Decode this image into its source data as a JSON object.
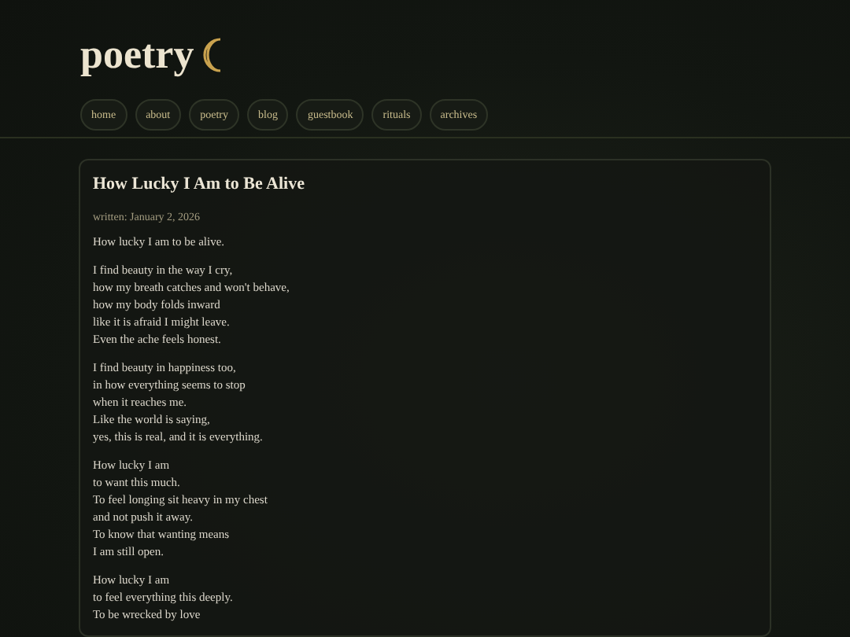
{
  "site": {
    "title": "poetry",
    "nav": [
      {
        "label": "home"
      },
      {
        "label": "about"
      },
      {
        "label": "poetry"
      },
      {
        "label": "blog"
      },
      {
        "label": "guestbook"
      },
      {
        "label": "rituals"
      },
      {
        "label": "archives"
      }
    ]
  },
  "post": {
    "title": "How Lucky I Am to Be Alive",
    "date": "written: January 2, 2026",
    "stanzas": [
      [
        "How lucky I am to be alive."
      ],
      [
        "I find beauty in the way I cry,",
        "how my breath catches and won't behave,",
        "how my body folds inward",
        "like it is afraid I might leave.",
        "Even the ache feels honest."
      ],
      [
        "I find beauty in happiness too,",
        "in how everything seems to stop",
        "when it reaches me.",
        "Like the world is saying,",
        "yes, this is real, and it is everything."
      ],
      [
        "How lucky I am",
        "to want this much.",
        "To feel longing sit heavy in my chest",
        "and not push it away.",
        "To know that wanting means",
        "I am still open."
      ],
      [
        "How lucky I am",
        "to feel everything this deeply.",
        "To be wrecked by love"
      ]
    ]
  }
}
